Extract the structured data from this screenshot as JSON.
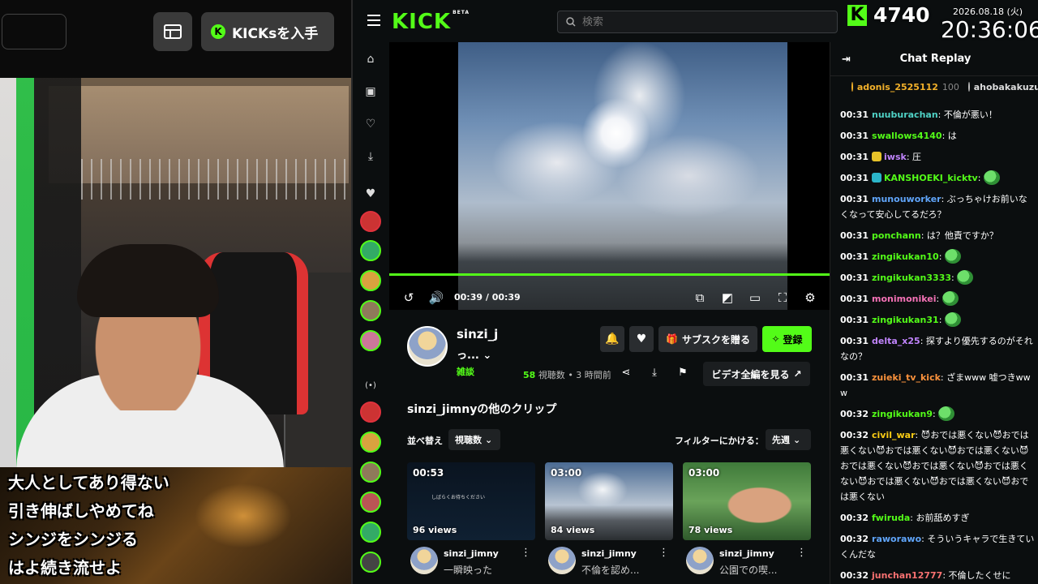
{
  "overlay": {
    "kicks_button": "KICKsを入手",
    "subtitles": [
      "大人としてあり得ない",
      "引き伸ばしやめてね",
      "シンジをシンジる",
      "はよ続き流せよ"
    ],
    "kick_count": "4740",
    "date": "2026.08.18 (火)",
    "time": "20:36:06"
  },
  "header": {
    "logo": "KICK",
    "logo_tag": "BETA",
    "search_placeholder": "検索"
  },
  "player": {
    "timecode": "00:39 / 00:39",
    "progress": 1.0
  },
  "channel": {
    "name": "sinzi_j",
    "clip_title": "っ...",
    "category": "雑談",
    "views_count": "58",
    "views_label": "視聴数",
    "time_ago": "• 3 時間前",
    "gift_sub": "サブスクを贈る",
    "follow": "登録",
    "full_video": "ビデオ全編を見る"
  },
  "clips": {
    "section_title": "sinzi_jimnyの他のクリップ",
    "sort_label": "並べ替え",
    "sort_value": "視聴数",
    "filter_label": "フィルターにかける：",
    "filter_value": "先週",
    "items": [
      {
        "duration": "00:53",
        "views": "96 views",
        "author": "sinzi_jimny",
        "title": "一瞬映った",
        "inner_text": "しばらくお待ちください"
      },
      {
        "duration": "03:00",
        "views": "84 views",
        "author": "sinzi_jimny",
        "title": "不倫を認め..."
      },
      {
        "duration": "03:00",
        "views": "78 views",
        "author": "sinzi_jimny",
        "title": "公園での喫..."
      }
    ]
  },
  "chat": {
    "title": "Chat Replay",
    "gifters": [
      {
        "name": "adonis_2525112",
        "count": "100"
      },
      {
        "name": "ahobakakuzu"
      }
    ],
    "messages": [
      {
        "time": "00:31",
        "user": "nuuburachan",
        "color": "#4fd1c5",
        "text": "不倫が悪い！"
      },
      {
        "time": "00:31",
        "user": "swallows4140",
        "color": "#53fc18",
        "text": "は"
      },
      {
        "time": "00:31",
        "user": "iwsk",
        "color": "#c084fc",
        "text": "圧",
        "badge": "#e6c229"
      },
      {
        "time": "00:31",
        "user": "KANSHOEKI_kicktv",
        "color": "#53fc18",
        "text": "",
        "badge": "#2bb5c9",
        "emote": true
      },
      {
        "time": "00:31",
        "user": "munouworker",
        "color": "#60a5fa",
        "text": "ぶっちゃけお前いなくなって安心してるだろ？"
      },
      {
        "time": "00:31",
        "user": "ponchann",
        "color": "#53fc18",
        "text": "は？他責ですか？"
      },
      {
        "time": "00:31",
        "user": "zingikukan10",
        "color": "#53fc18",
        "text": "",
        "emote": true
      },
      {
        "time": "00:31",
        "user": "zingikukan3333",
        "color": "#53fc18",
        "text": "",
        "emote": true
      },
      {
        "time": "00:31",
        "user": "monimonikei",
        "color": "#f472b6",
        "text": "",
        "emote": true
      },
      {
        "time": "00:31",
        "user": "zingikukan31",
        "color": "#53fc18",
        "text": "",
        "emote": true
      },
      {
        "time": "00:31",
        "user": "delta_x25",
        "color": "#c084fc",
        "text": "探すより優先するのがそれなの？"
      },
      {
        "time": "00:31",
        "user": "zuieki_tv_kick",
        "color": "#fb923c",
        "text": "ざまwww 嘘つきwww"
      },
      {
        "time": "00:32",
        "user": "zingikukan9",
        "color": "#53fc18",
        "text": "",
        "emote": true
      },
      {
        "time": "00:32",
        "user": "civil_war",
        "color": "#facc15",
        "text": "😈おでは悪くない😈おでは悪くない😈おでは悪くない😈おでは悪くない😈おでは悪くない😈おでは悪くない😈おでは悪くない😈おでは悪くない😈おでは悪くない😈おでは悪くない"
      },
      {
        "time": "00:32",
        "user": "fwiruda",
        "color": "#53fc18",
        "text": "お前舐めすぎ"
      },
      {
        "time": "00:32",
        "user": "raworawo",
        "color": "#60a5fa",
        "text": "そういうキャラで生きていくんだな"
      },
      {
        "time": "00:32",
        "user": "junchan12777",
        "color": "#f87171",
        "text": "不倫したくせに"
      }
    ]
  }
}
